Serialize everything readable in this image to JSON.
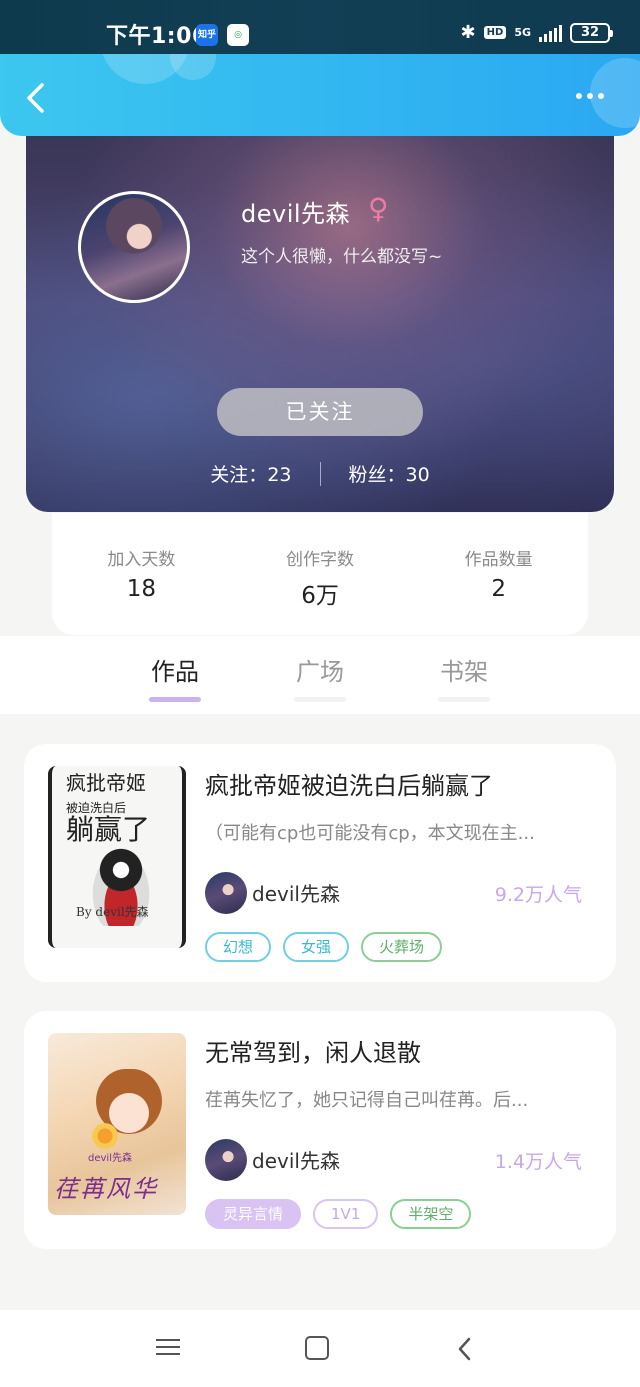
{
  "status_bar": {
    "time": "下午1:06",
    "apps": [
      "知乎",
      "中国移动"
    ],
    "network": "5G",
    "battery": "32"
  },
  "profile": {
    "name": "devil先森",
    "gender_icon": "♀",
    "bio": "这个人很懒，什么都没写~",
    "follow_button": "已关注",
    "following_label": "关注：",
    "following_count": "23",
    "fans_label": "粉丝：",
    "fans_count": "30"
  },
  "stats": [
    {
      "label": "加入天数",
      "value": "18"
    },
    {
      "label": "创作字数",
      "value": "6万"
    },
    {
      "label": "作品数量",
      "value": "2"
    }
  ],
  "tabs": [
    {
      "label": "作品",
      "active": true
    },
    {
      "label": "广场",
      "active": false
    },
    {
      "label": "书架",
      "active": false
    }
  ],
  "works": [
    {
      "title": "疯批帝姬被迫洗白后躺赢了",
      "description": "（可能有cp也可能没有cp，本文现在主...",
      "author": "devil先森",
      "popularity": "9.2万人气",
      "tags": [
        "幻想",
        "女强",
        "火葬场"
      ],
      "cover_text": "疯批帝姬",
      "cover_sub": "被迫洗白后",
      "cover_big": "躺赢了",
      "cover_by": "By devil先森"
    },
    {
      "title": "无常驾到，闲人退散",
      "description": "荏苒失忆了，她只记得自己叫荏苒。后...",
      "author": "devil先森",
      "popularity": "1.4万人气",
      "tags": [
        "灵异言情",
        "1V1",
        "半架空"
      ],
      "cover_text": "荏苒风华",
      "cover_author": "devil先森"
    }
  ],
  "colors": {
    "header": "#2aa8f2",
    "accent": "#c9b2ee",
    "popularity": "#c8a8ea",
    "gender": "#ef7aa4"
  }
}
